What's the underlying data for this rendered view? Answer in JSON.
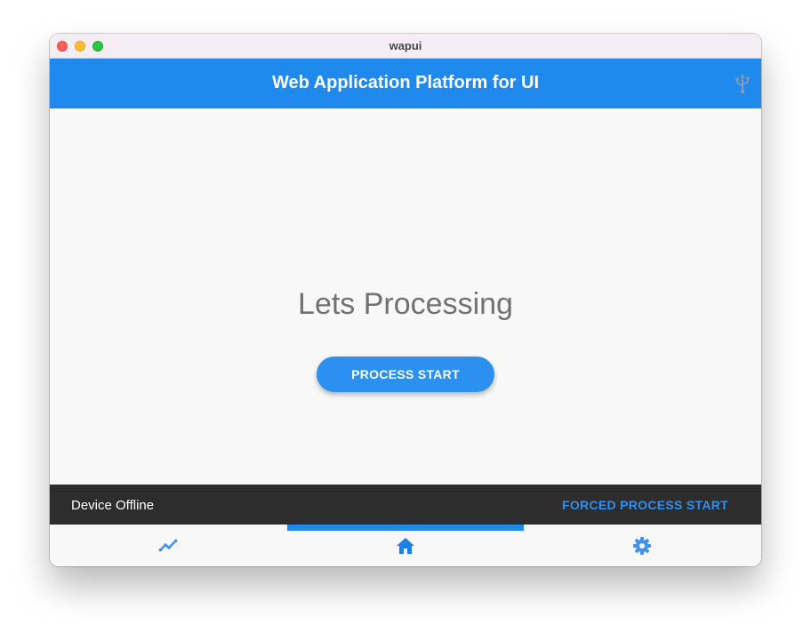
{
  "window": {
    "title": "wapui"
  },
  "appbar": {
    "title": "Web Application Platform for UI",
    "action_icon": "usb-icon"
  },
  "main": {
    "headline": "Lets Processing",
    "process_button_label": "PROCESS START"
  },
  "snackbar": {
    "message": "Device Offline",
    "action_label": "FORCED PROCESS START"
  },
  "bottom_nav": {
    "items": [
      {
        "icon": "trending-up-icon",
        "selected": false
      },
      {
        "icon": "home-icon",
        "selected": true
      },
      {
        "icon": "gear-icon",
        "selected": false
      }
    ]
  },
  "colors": {
    "primary": "#2089ee",
    "button": "#2b90f0",
    "snackbar_bg": "#2d2d2d",
    "snackbar_action": "#2f8ff0",
    "headline_text": "#717171",
    "background": "#f8f8f8"
  }
}
